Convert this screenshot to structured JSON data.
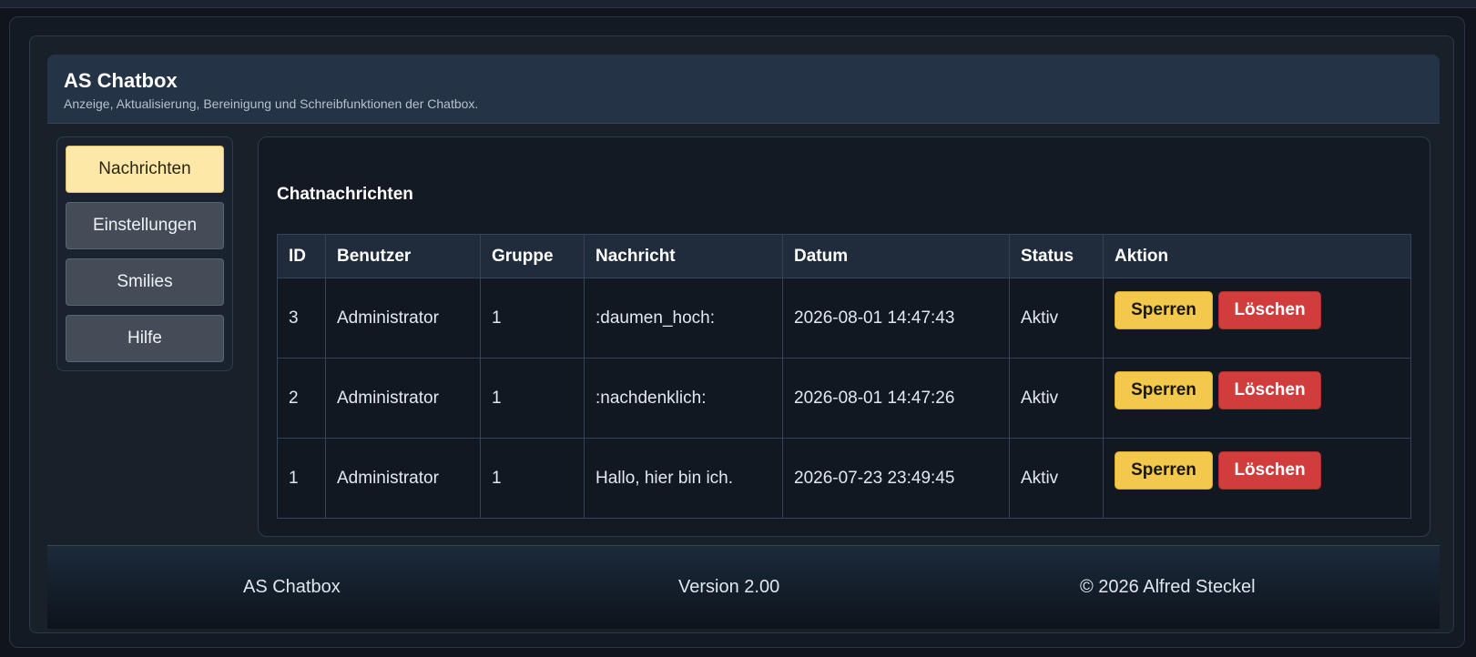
{
  "header": {
    "title": "AS Chatbox",
    "subtitle": "Anzeige, Aktualisierung, Bereinigung und Schreibfunktionen der Chatbox."
  },
  "sidebar": {
    "items": [
      {
        "label": "Nachrichten",
        "active": true
      },
      {
        "label": "Einstellungen",
        "active": false
      },
      {
        "label": "Smilies",
        "active": false
      },
      {
        "label": "Hilfe",
        "active": false
      }
    ]
  },
  "main": {
    "section_title": "Chatnachrichten",
    "columns": [
      "ID",
      "Benutzer",
      "Gruppe",
      "Nachricht",
      "Datum",
      "Status",
      "Aktion"
    ],
    "rows": [
      {
        "id": "3",
        "user": "Administrator",
        "group": "1",
        "message": ":daumen_hoch:",
        "date": "2026-08-01 14:47:43",
        "status": "Aktiv",
        "lock_label": "Sperren",
        "delete_label": "Löschen"
      },
      {
        "id": "2",
        "user": "Administrator",
        "group": "1",
        "message": ":nachdenklich:",
        "date": "2026-08-01 14:47:26",
        "status": "Aktiv",
        "lock_label": "Sperren",
        "delete_label": "Löschen"
      },
      {
        "id": "1",
        "user": "Administrator",
        "group": "1",
        "message": "Hallo, hier bin ich.",
        "date": "2026-07-23 23:49:45",
        "status": "Aktiv",
        "lock_label": "Sperren",
        "delete_label": "Löschen"
      }
    ]
  },
  "footer": {
    "app_name": "AS Chatbox",
    "version": "Version 2.00",
    "copyright": "© 2026 Alfred Steckel"
  },
  "colors": {
    "accent_active": "#fde8a8",
    "lock_button": "#f2c94c",
    "delete_button": "#d13c3c"
  }
}
